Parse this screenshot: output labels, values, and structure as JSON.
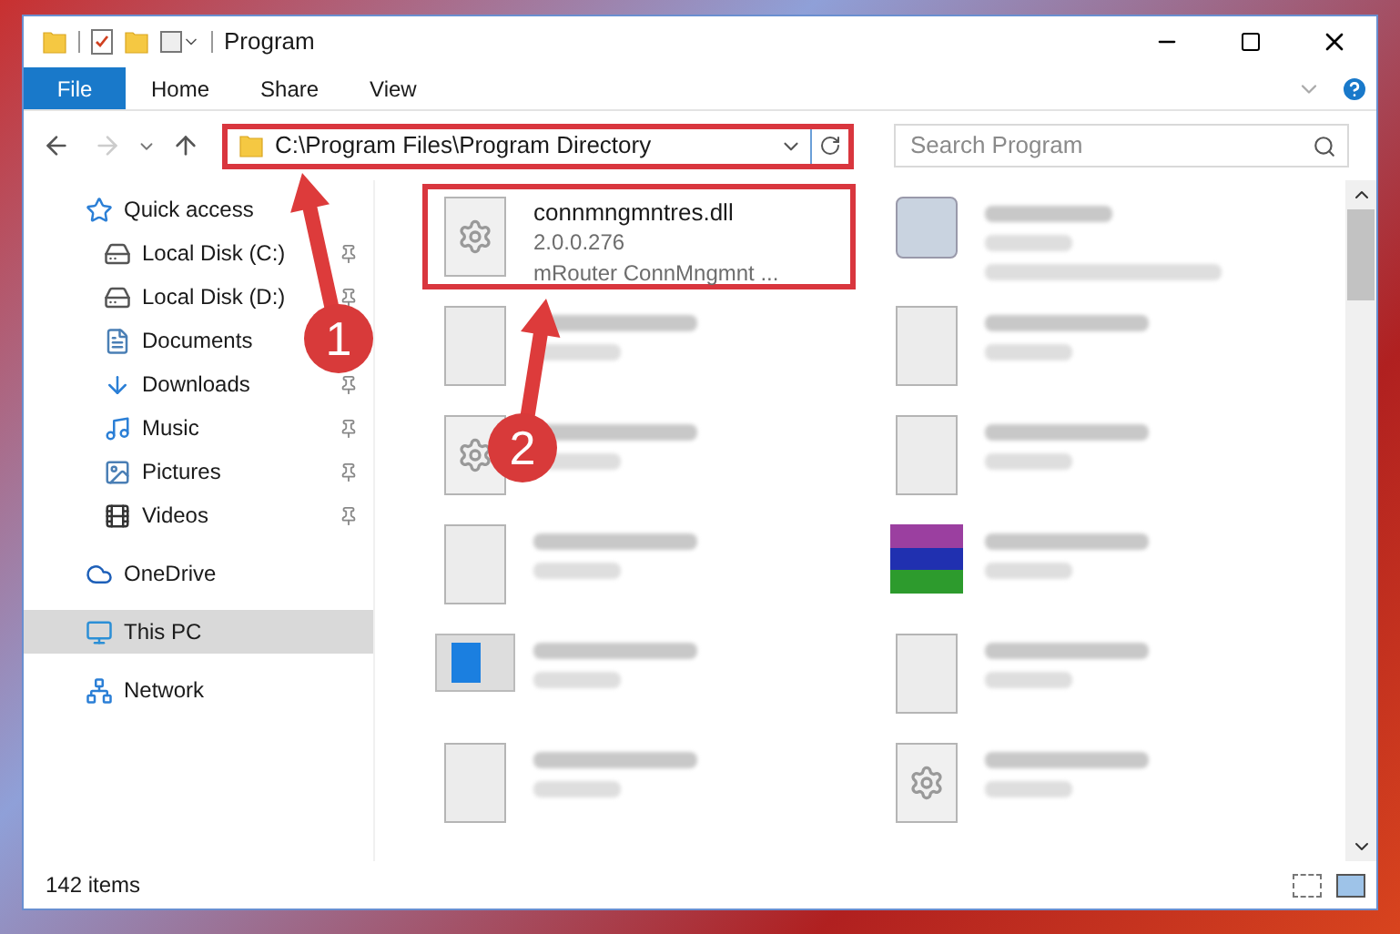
{
  "window": {
    "title": "Program"
  },
  "ribbon_tabs": [
    {
      "label": "File",
      "kind": "menu"
    },
    {
      "label": "Home",
      "kind": "tab"
    },
    {
      "label": "Share",
      "kind": "tab"
    },
    {
      "label": "View",
      "kind": "tab"
    }
  ],
  "nav": {
    "forward_disabled": true
  },
  "address": {
    "path": "C:\\Program Files\\Program Directory",
    "highlighted": true
  },
  "search": {
    "placeholder": "Search Program"
  },
  "sidebar": {
    "items": [
      {
        "label": "Quick access",
        "kind": "star",
        "selected": false,
        "children": [
          {
            "label": "Local Disk (C:)",
            "kind": "drive-os",
            "pinned": true,
            "selected": false
          },
          {
            "label": "Local Disk (D:)",
            "kind": "drive",
            "pinned": true,
            "selected": false
          },
          {
            "label": "Documents",
            "kind": "documents",
            "pinned": false,
            "selected": false
          },
          {
            "label": "Downloads",
            "kind": "downloads",
            "pinned": true,
            "selected": false
          },
          {
            "label": "Music",
            "kind": "music",
            "pinned": true,
            "selected": false
          },
          {
            "label": "Pictures",
            "kind": "pictures",
            "pinned": true,
            "selected": false
          },
          {
            "label": "Videos",
            "kind": "videos",
            "pinned": true,
            "selected": false
          }
        ]
      },
      {
        "label": "OneDrive",
        "kind": "cloud",
        "selected": false
      },
      {
        "label": "This PC",
        "kind": "pc",
        "selected": true
      },
      {
        "label": "Network",
        "kind": "network",
        "selected": false
      }
    ]
  },
  "files": [
    {
      "name": "connmngmntres.dll",
      "lines": [
        "2.0.0.276",
        "mRouter ConnMngmnt ..."
      ],
      "kind": "gear",
      "highlighted": true
    },
    {
      "kind": "app",
      "highlighted": false
    },
    {
      "kind": "blank",
      "highlighted": false
    },
    {
      "kind": "blank",
      "highlighted": false
    },
    {
      "kind": "gear",
      "highlighted": false
    },
    {
      "kind": "blank",
      "highlighted": false
    },
    {
      "kind": "blank",
      "highlighted": false
    },
    {
      "kind": "archive",
      "highlighted": false
    },
    {
      "kind": "installer",
      "highlighted": false
    },
    {
      "kind": "blank",
      "highlighted": false
    },
    {
      "kind": "blank",
      "highlighted": false
    },
    {
      "kind": "gear",
      "highlighted": false
    }
  ],
  "status_bar": {
    "item_count": "142 items"
  },
  "annotations": [
    {
      "number": "1"
    },
    {
      "number": "2"
    }
  ]
}
